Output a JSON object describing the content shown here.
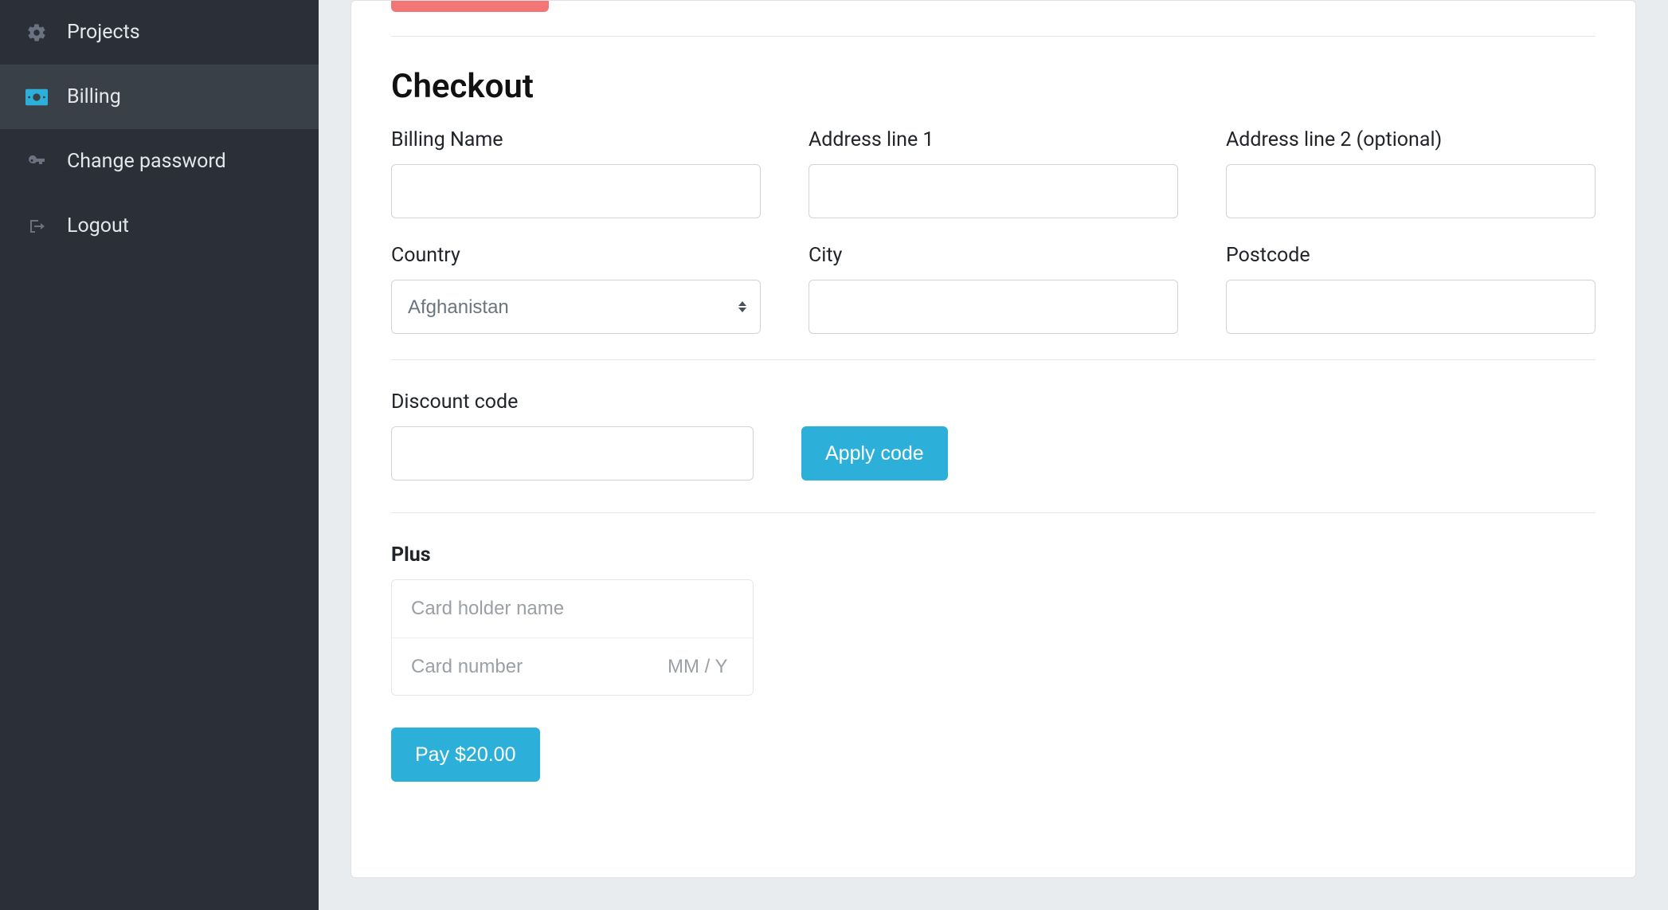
{
  "sidebar": {
    "items": [
      {
        "label": "Projects"
      },
      {
        "label": "Billing"
      },
      {
        "label": "Change password"
      },
      {
        "label": "Logout"
      }
    ]
  },
  "checkout": {
    "heading": "Checkout",
    "labels": {
      "billing_name": "Billing Name",
      "address1": "Address line 1",
      "address2": "Address line 2 (optional)",
      "country": "Country",
      "city": "City",
      "postcode": "Postcode",
      "discount": "Discount code"
    },
    "country_selected": "Afghanistan",
    "apply_code_label": "Apply code",
    "plan_name": "Plus",
    "card": {
      "holder_placeholder": "Card holder name",
      "number_placeholder": "Card number",
      "expiry_placeholder": "MM / Y"
    },
    "pay_button_label": "Pay $20.00"
  }
}
